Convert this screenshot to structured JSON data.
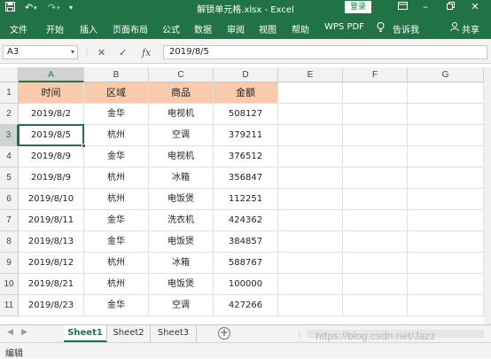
{
  "window": {
    "title": "解锁单元格.xlsx  -  Excel",
    "login_label": "登录",
    "quick_access": [
      "save-icon",
      "undo-icon",
      "redo-icon"
    ],
    "controls": [
      "ribbon-display-icon",
      "minimize-icon",
      "restore-icon",
      "close-icon"
    ]
  },
  "ribbon": {
    "tabs": [
      "文件",
      "开始",
      "插入",
      "页面布局",
      "公式",
      "数据",
      "审阅",
      "视图",
      "帮助",
      "WPS PDF",
      "告诉我"
    ],
    "share_label": "共享"
  },
  "formula_bar": {
    "name_box": "A3",
    "formula": "2019/8/5",
    "icons": [
      "cancel-icon",
      "enter-icon",
      "function-icon"
    ]
  },
  "sheet": {
    "columns": [
      "A",
      "B",
      "C",
      "D",
      "E",
      "F",
      "G"
    ],
    "selected_column": "A",
    "rows": [
      "1",
      "2",
      "3",
      "4",
      "5",
      "6",
      "7",
      "8",
      "9",
      "10",
      "11"
    ],
    "selected_row": "3",
    "header": [
      "时间",
      "区域",
      "商品",
      "金额"
    ],
    "data": [
      [
        "2019/8/2",
        "金华",
        "电视机",
        "508127"
      ],
      [
        "2019/8/5",
        "杭州",
        "空调",
        "379211"
      ],
      [
        "2019/8/9",
        "金华",
        "电视机",
        "376512"
      ],
      [
        "2019/8/9",
        "杭州",
        "冰箱",
        "356847"
      ],
      [
        "2019/8/10",
        "杭州",
        "电饭煲",
        "112251"
      ],
      [
        "2019/8/11",
        "金华",
        "洗衣机",
        "424362"
      ],
      [
        "2019/8/13",
        "金华",
        "电饭煲",
        "384857"
      ],
      [
        "2019/8/12",
        "杭州",
        "冰箱",
        "588767"
      ],
      [
        "2019/8/21",
        "杭州",
        "电饭煲",
        "100000"
      ],
      [
        "2019/8/23",
        "金华",
        "空调",
        "427266"
      ]
    ],
    "header_fill": "#f8cbad",
    "accent": "#217346"
  },
  "sheet_tabs": {
    "tabs": [
      "Sheet1",
      "Sheet2",
      "Sheet3"
    ],
    "active": "Sheet1"
  },
  "status": {
    "mode": "编辑"
  },
  "watermark": "https://blog.csdn.net/Jazz"
}
